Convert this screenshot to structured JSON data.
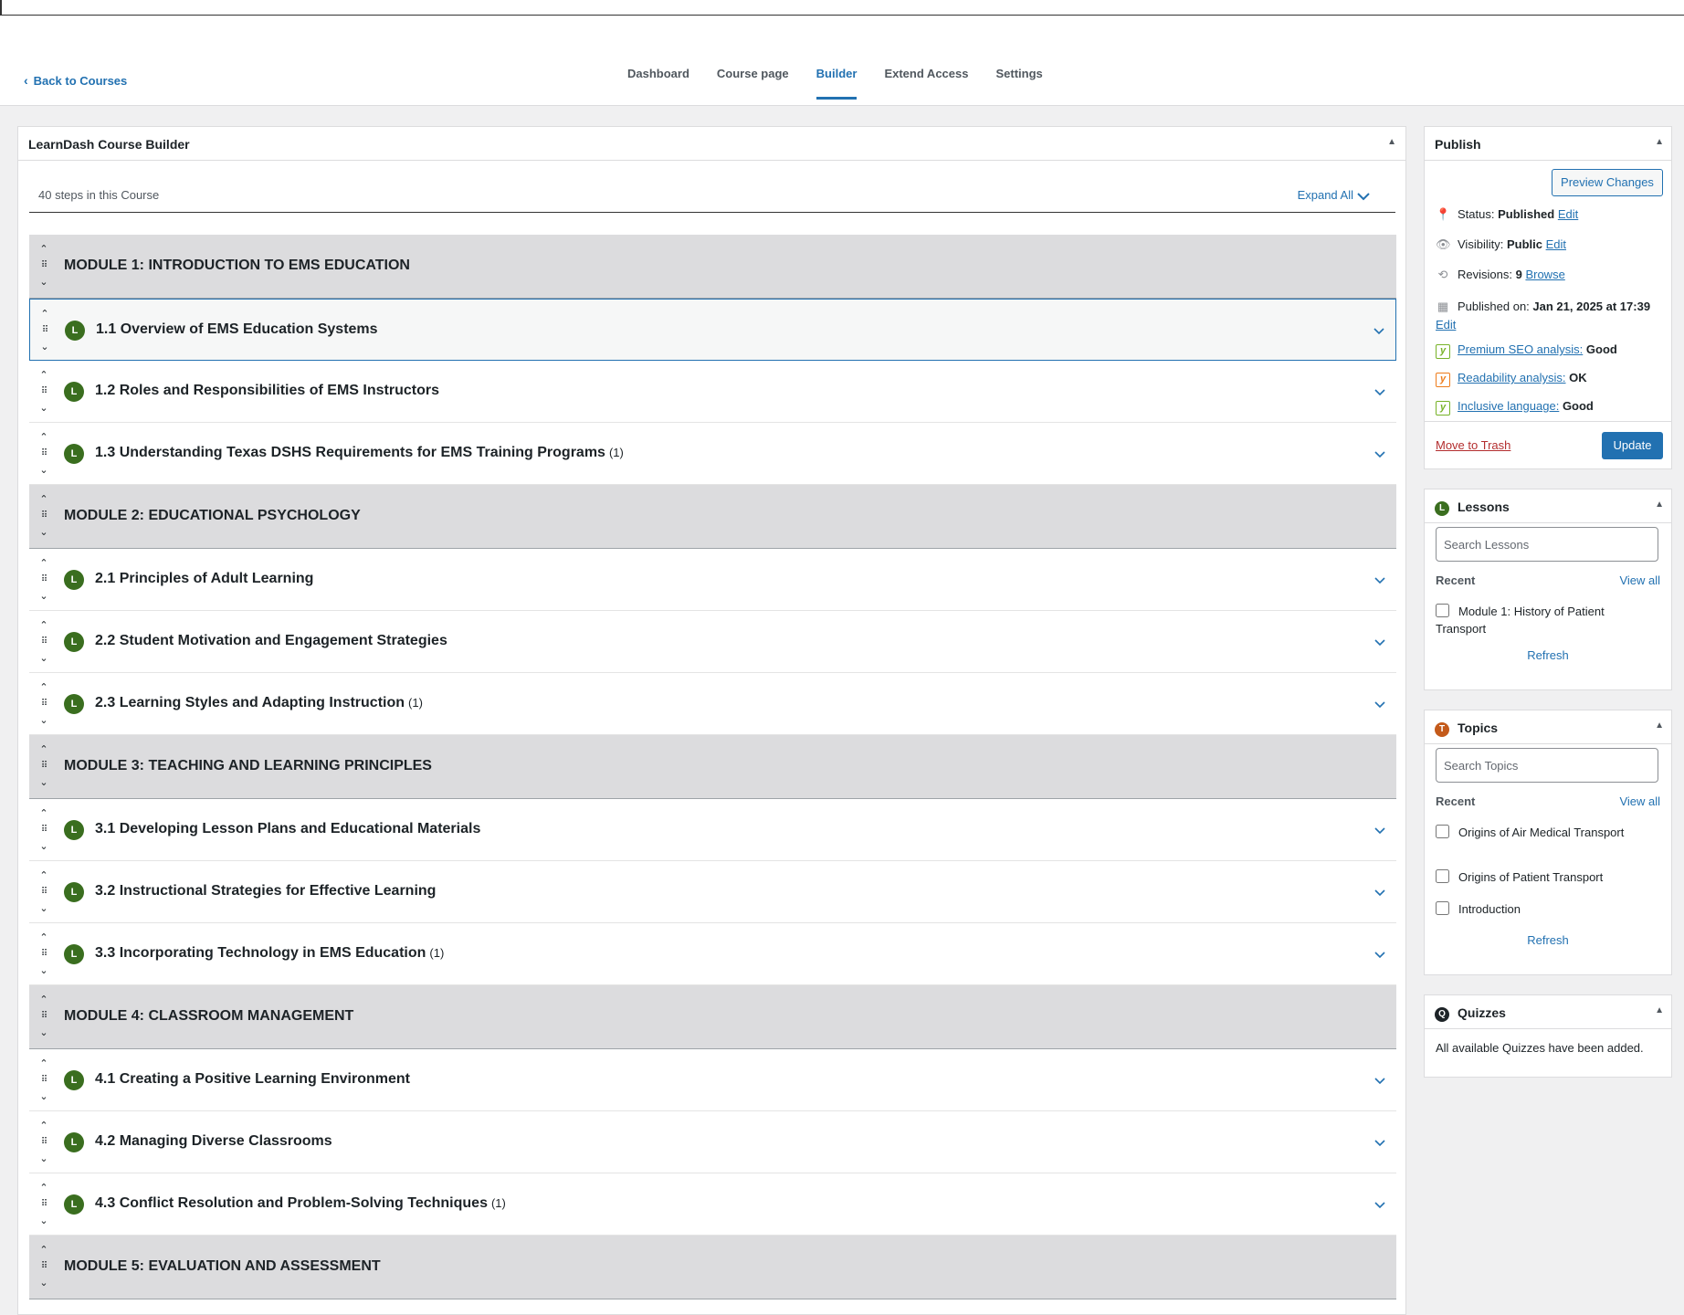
{
  "nav": {
    "back_label": "Back to Courses",
    "tabs": [
      {
        "label": "Dashboard",
        "active": false
      },
      {
        "label": "Course page",
        "active": false
      },
      {
        "label": "Builder",
        "active": true
      },
      {
        "label": "Extend Access",
        "active": false
      },
      {
        "label": "Settings",
        "active": false
      }
    ]
  },
  "builder": {
    "title": "LearnDash Course Builder",
    "steps_count": "40 steps in this Course",
    "expand_all": "Expand All",
    "rows": [
      {
        "type": "module",
        "title": "MODULE 1: INTRODUCTION TO EMS EDUCATION"
      },
      {
        "type": "lesson",
        "title": "1.1 Overview of EMS Education Systems",
        "count": "",
        "selected": true
      },
      {
        "type": "lesson",
        "title": "1.2 Roles and Responsibilities of EMS Instructors",
        "count": ""
      },
      {
        "type": "lesson",
        "title": "1.3 Understanding Texas DSHS Requirements for EMS Training Programs",
        "count": "(1)"
      },
      {
        "type": "module",
        "title": "MODULE 2: EDUCATIONAL PSYCHOLOGY"
      },
      {
        "type": "lesson",
        "title": "2.1 Principles of Adult Learning",
        "count": ""
      },
      {
        "type": "lesson",
        "title": "2.2 Student Motivation and Engagement Strategies",
        "count": ""
      },
      {
        "type": "lesson",
        "title": "2.3 Learning Styles and Adapting Instruction",
        "count": "(1)"
      },
      {
        "type": "module",
        "title": "MODULE 3: TEACHING AND LEARNING PRINCIPLES"
      },
      {
        "type": "lesson",
        "title": "3.1 Developing Lesson Plans and Educational Materials",
        "count": ""
      },
      {
        "type": "lesson",
        "title": "3.2 Instructional Strategies for Effective Learning",
        "count": ""
      },
      {
        "type": "lesson",
        "title": "3.3 Incorporating Technology in EMS Education",
        "count": "(1)"
      },
      {
        "type": "module",
        "title": "MODULE 4: CLASSROOM MANAGEMENT"
      },
      {
        "type": "lesson",
        "title": "4.1 Creating a Positive Learning Environment",
        "count": ""
      },
      {
        "type": "lesson",
        "title": "4.2 Managing Diverse Classrooms",
        "count": ""
      },
      {
        "type": "lesson",
        "title": "4.3 Conflict Resolution and Problem-Solving Techniques",
        "count": "(1)"
      },
      {
        "type": "module",
        "title": "MODULE 5: EVALUATION AND ASSESSMENT"
      }
    ],
    "lesson_badge": "L"
  },
  "publish": {
    "title": "Publish",
    "preview_label": "Preview Changes",
    "status_label": "Status:",
    "status_value": "Published",
    "status_edit": "Edit",
    "visibility_label": "Visibility:",
    "visibility_value": "Public",
    "visibility_edit": "Edit",
    "revisions_label": "Revisions:",
    "revisions_value": "9",
    "revisions_link": "Browse",
    "published_label": "Published on:",
    "published_value": "Jan 21, 2025 at 17:39",
    "published_edit": "Edit",
    "seo_link": "Premium SEO analysis:",
    "seo_value": "Good",
    "readability_link": "Readability analysis:",
    "readability_value": "OK",
    "inclusive_link": "Inclusive language:",
    "inclusive_value": "Good",
    "trash_label": "Move to Trash",
    "update_label": "Update"
  },
  "lessons_box": {
    "title": "Lessons",
    "badge": "L",
    "search_placeholder": "Search Lessons",
    "recent_label": "Recent",
    "view_all": "View all",
    "items": [
      "Module 1: History of Patient Transport"
    ],
    "refresh": "Refresh"
  },
  "topics_box": {
    "title": "Topics",
    "badge": "T",
    "search_placeholder": "Search Topics",
    "recent_label": "Recent",
    "view_all": "View all",
    "items": [
      "Origins of Air Medical Transport",
      "Origins of Patient Transport",
      "Introduction"
    ],
    "refresh": "Refresh"
  },
  "quizzes_box": {
    "title": "Quizzes",
    "badge": "Q",
    "message": "All available Quizzes have been added."
  },
  "colors": {
    "accent": "#2271b1",
    "lesson_badge": "#3a6e1f",
    "topic_badge": "#c45a1a",
    "quiz_badge": "#1d2327",
    "module_bg": "#dcdcde"
  }
}
